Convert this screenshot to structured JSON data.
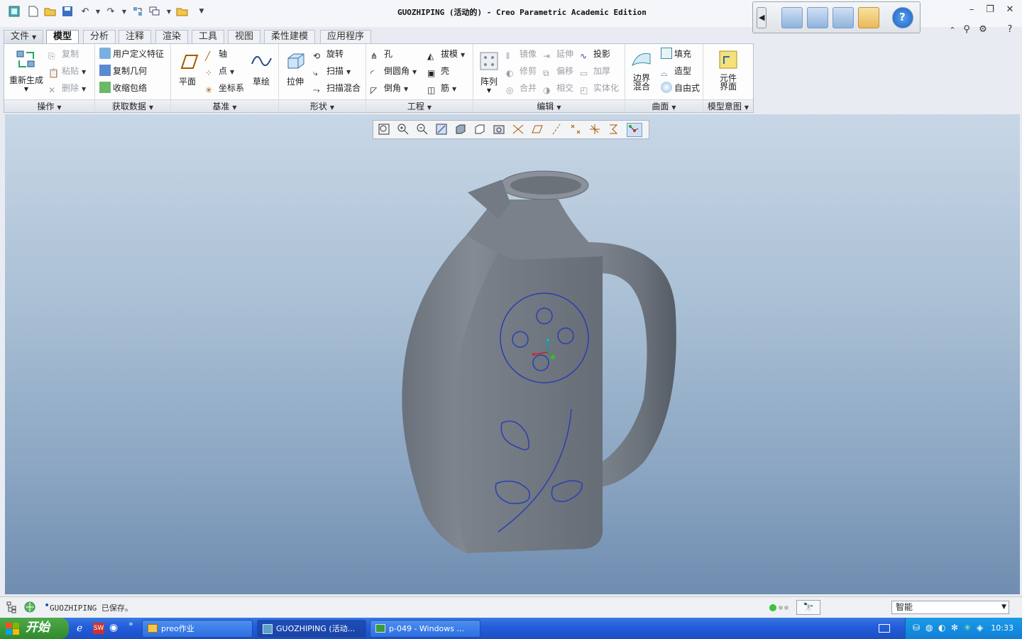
{
  "window": {
    "title": "GUOZHIPING (活动的) - Creo Parametric Academic Edition"
  },
  "tabs": [
    "文件",
    "模型",
    "分析",
    "注释",
    "渲染",
    "工具",
    "视图",
    "柔性建模",
    "应用程序"
  ],
  "active_tab": "模型",
  "ribbon": {
    "operations": {
      "regenerate": "重新生成",
      "copy": "复制",
      "paste": "粘贴",
      "delete": "删除",
      "label": "操作"
    },
    "get_data": {
      "udf": "用户定义特征",
      "copy_geom": "复制几何",
      "shrinkwrap": "收缩包络",
      "label": "获取数据"
    },
    "datum": {
      "plane": "平面",
      "axis": "轴",
      "point": "点",
      "csys": "坐标系",
      "sketch": "草绘",
      "label": "基准"
    },
    "shapes": {
      "extrude": "拉伸",
      "revolve": "旋转",
      "sweep": "扫描",
      "swept_blend": "扫描混合",
      "label": "形状"
    },
    "engineering": {
      "hole": "孔",
      "round": "倒圆角",
      "chamfer": "倒角",
      "draft": "拔模",
      "shell": "壳",
      "rib": "筋",
      "label": "工程"
    },
    "editing": {
      "pattern": "阵列",
      "mirror": "镜像",
      "trim": "修剪",
      "merge": "合并",
      "extend": "延伸",
      "offset": "偏移",
      "intersect": "相交",
      "project": "投影",
      "thicken": "加厚",
      "solidify": "实体化",
      "label": "编辑"
    },
    "surfaces": {
      "boundary_blend": "边界\n混合",
      "fill": "填充",
      "style": "造型",
      "freestyle": "自由式",
      "label": "曲面"
    },
    "model_intent": {
      "component_interface": "元件\n界面",
      "label": "模型意图"
    }
  },
  "status": {
    "message": "GUOZHIPING 已保存。",
    "filter_value": "智能"
  },
  "taskbar": {
    "start": "开始",
    "tasks": [
      "preo作业",
      "GUOZHIPING (活动...",
      "p-049 - Windows ..."
    ],
    "clock": "10:33"
  }
}
